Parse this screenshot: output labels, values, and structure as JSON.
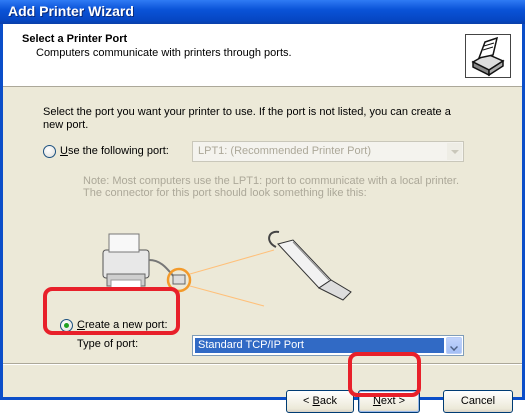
{
  "window": {
    "title": "Add Printer Wizard"
  },
  "header": {
    "title": "Select a Printer Port",
    "subtitle": "Computers communicate with printers through ports."
  },
  "body": {
    "intro": "Select the port you want your printer to use.  If the port is not listed, you can create a new port.",
    "use_port_option": {
      "accel": "U",
      "rest": "se the following port:",
      "selected": false
    },
    "port_select": {
      "value": "LPT1: (Recommended Printer Port)",
      "enabled": false
    },
    "note": "Note: Most computers use the LPT1: port to communicate with a local printer. The connector for this port should look something like this:",
    "create_port_option": {
      "accel": "C",
      "rest": "reate a new port:",
      "selected": true
    },
    "type_label": "Type of port:",
    "type_select": {
      "value": "Standard TCP/IP Port"
    }
  },
  "buttons": {
    "back": {
      "prefix": "< ",
      "accel": "B",
      "rest": "ack"
    },
    "next": {
      "accel": "N",
      "rest": "ext >"
    },
    "cancel": "Cancel"
  },
  "colors": {
    "highlight": "#e8202a",
    "title_bar": "#0a53d8",
    "selection": "#316ac5"
  },
  "icons": [
    "printer-wizard-icon",
    "printer-illustration",
    "parallel-cable-illustration"
  ]
}
